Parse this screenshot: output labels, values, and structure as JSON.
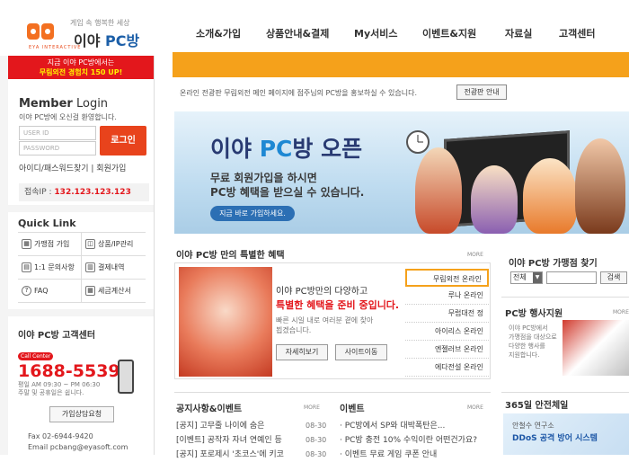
{
  "logo": {
    "tagline": "게임 속 행복한 세상",
    "name_prefix": "이야",
    "name_suffix": "PC방",
    "sub": "EYA INTERACTIVE"
  },
  "promo": {
    "line1": "지금 이야 PC방에서는",
    "line2": "무림외전 경험치 150 UP!"
  },
  "login": {
    "title_bold": "Member",
    "title_rest": " Login",
    "welcome": "이야 PC방에 오신걸 환영합니다.",
    "userid_placeholder": "USER ID",
    "password_placeholder": "PASSWORD",
    "login_button": "로그인",
    "find_links": "아이디/패스워드찾기 | 회원가입",
    "ip_label": "접속IP :",
    "ip_value": "132.123.123.123"
  },
  "quick": {
    "title": "Quick Link",
    "items": [
      "가맹점 가입",
      "상품/IP관리",
      "1:1 문의사항",
      "결제내역",
      "FAQ",
      "세금계산서"
    ]
  },
  "customer_center": {
    "title": "이야 PC방 고객센터",
    "badge": "Call Center",
    "phone": "1688-5539",
    "hours1": "평일 AM 09:30 ~ PM 06:30",
    "hours2": "주말 및 공휴일은 쉽니다.",
    "consult_button": "가입상담요청",
    "fax": "Fax 02-6944-9420",
    "email": "Email pcbang@eyasoft.com"
  },
  "nav": {
    "items": [
      "소개&가입",
      "상품안내&결제",
      "My서비스",
      "이벤트&지원",
      "자료실",
      "고객센터"
    ]
  },
  "notice_bar": {
    "text": "온라인 전광판 무림외전 메인 페이지에 점주님의 PC방을 홍보하실 수 있습니다.",
    "button": "전광판 안내"
  },
  "banner": {
    "title_prefix": "이야",
    "title_pc": "PC",
    "title_suffix": "방 오픈",
    "sub1": "무료 회원가입을 하시면",
    "sub2": "PC방 혜택을 받으실 수 있습니다.",
    "button": "지금 바로 가입하세요."
  },
  "benefit": {
    "title": "이야 PC방 만의 특별한 혜택",
    "more": "MORE",
    "text1": "이야 PC방만의 다양하고",
    "text2": "특별한 혜택을 준비 중입니다.",
    "text3": "빠른 시일 내로 여러분 곁에 찾아",
    "text4": "뵙겠습니다.",
    "button1": "자세히보기",
    "button2": "사이트이동",
    "tabs": [
      "무림외전 온라인",
      "루나 온라인",
      "무럽대전 정",
      "아이리스 온라인",
      "엔젤러브 온라인",
      "에다전설 온라인"
    ]
  },
  "store_search": {
    "title": "이야 PC방 가맹점 찾기",
    "select": "전체",
    "button": "검색"
  },
  "pc_event": {
    "title": "PC방 행사지원",
    "more": "MORE",
    "text1": "이야 PC방에서",
    "text2": "가맹점을 대상으로",
    "text3": "다양한 행사를",
    "text4": "지원합니다."
  },
  "notices": {
    "title": "공지사항&이벤트",
    "more": "MORE",
    "items": [
      "[공지] 고무줄 나이에 숨은",
      "[이벤트] 공작자 자녀 연예인 등",
      "[공지] 포로제시 '초코스'에 키코"
    ],
    "dates": [
      "08-30",
      "08-30",
      "08-30"
    ]
  },
  "events": {
    "title": "이벤트",
    "more": "MORE",
    "items": [
      "· PC방에서 SP와 대박폭탄은...",
      "· PC방 충전 10% 수익이란 어떤건가요?",
      "· 이벤트 무료 게임 쿠폰 안내"
    ]
  },
  "security": {
    "title": "365일 안전체일",
    "line1": "안철수 연구소",
    "line2": "DDoS 공격 방어 시스템"
  }
}
